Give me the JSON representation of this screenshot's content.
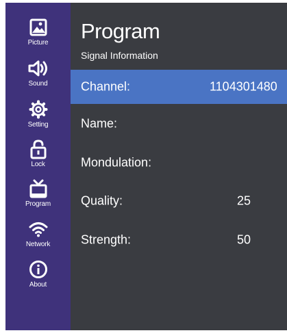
{
  "sidebar": {
    "items": [
      {
        "label": "Picture",
        "icon": "picture-icon"
      },
      {
        "label": "Sound",
        "icon": "speaker-icon"
      },
      {
        "label": "Setting",
        "icon": "gear-icon"
      },
      {
        "label": "Lock",
        "icon": "lock-icon"
      },
      {
        "label": "Program",
        "icon": "tv-icon"
      },
      {
        "label": "Network",
        "icon": "wifi-icon"
      },
      {
        "label": "About",
        "icon": "info-icon"
      }
    ],
    "active": "Program"
  },
  "header": {
    "title": "Program",
    "subtitle": "Signal Information"
  },
  "signal": {
    "rows": [
      {
        "label": "Channel:",
        "value": "1104301480"
      },
      {
        "label": "Name:",
        "value": ""
      },
      {
        "label": "Mondulation:",
        "value": ""
      },
      {
        "label": "Quality:",
        "value": "25"
      },
      {
        "label": "Strength:",
        "value": "50"
      }
    ]
  },
  "colors": {
    "sidebar": "#3f327b",
    "background": "#3a3c41",
    "highlight": "#4a74c4",
    "text": "#ffffff"
  }
}
